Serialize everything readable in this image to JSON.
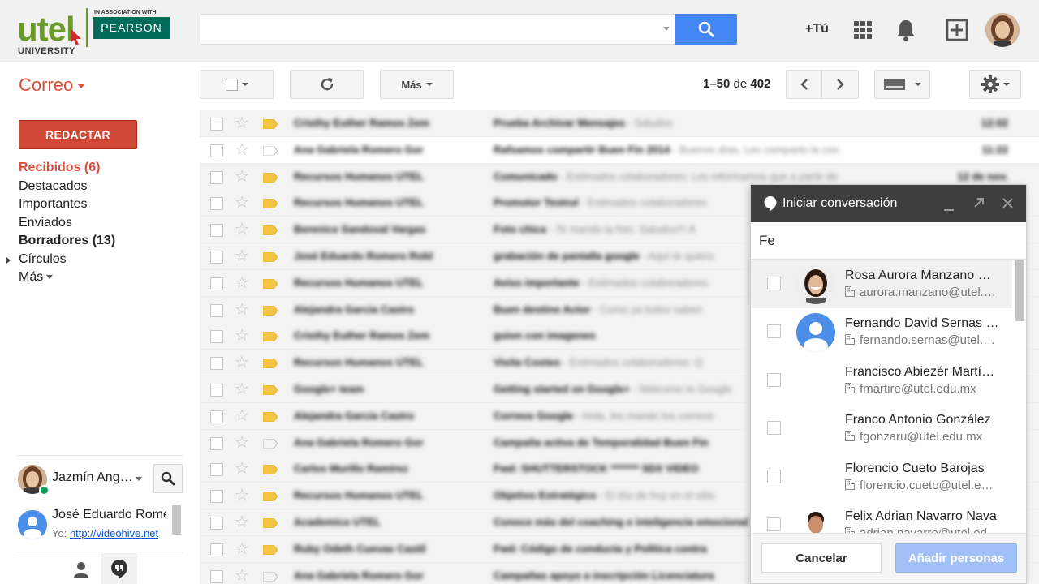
{
  "header": {
    "logo_main": "utel",
    "logo_sub": "UNIVERSITY",
    "logo_assoc": "IN ASSOCIATION WITH",
    "logo_partner": "PEARSON",
    "search_value": "",
    "plus_you": "+Tú",
    "icons": [
      "search-icon",
      "apps-grid-icon",
      "notification-bell-icon",
      "add-share-icon",
      "profile-avatar"
    ],
    "search_button_color": "#4285f4"
  },
  "toolbar": {
    "app_label": "Correo",
    "more_label": "Más",
    "pager_range": "1–50",
    "pager_of": "de",
    "pager_total": "402"
  },
  "nav": {
    "compose_label": "REDACTAR",
    "compose_color": "#d14836",
    "items": [
      {
        "label": "Recibidos (6)",
        "state": "active"
      },
      {
        "label": "Destacados",
        "state": ""
      },
      {
        "label": "Importantes",
        "state": ""
      },
      {
        "label": "Enviados",
        "state": ""
      },
      {
        "label": "Borradores (13)",
        "state": "bold"
      },
      {
        "label": "Círculos",
        "state": "expandable"
      },
      {
        "label": "Más",
        "state": "dropdown"
      }
    ]
  },
  "chat": {
    "me_name": "Jazmín Angélica",
    "contact_name": "José Eduardo Romero",
    "contact_prefix": "Yo:",
    "contact_link": "http://videohive.net"
  },
  "messages": [
    {
      "sender": "Cristhy Euther Ramos Zem",
      "subject": "Prueba Archivar Mensajes",
      "snippet": " - Saludos",
      "date": "12:02",
      "read": true,
      "tagged": true
    },
    {
      "sender": "Ana Gabriela Romero Gor",
      "subject": "Rafsamos compartir Buen Fin 2014",
      "snippet": " - Buenos días, Les comparto la con",
      "date": "11:22",
      "read": false,
      "tagged": false
    },
    {
      "sender": "Recursos Humanos UTEL",
      "subject": "Comunicado",
      "snippet": " - Estimados colaboradores: Les informamos que a partir de",
      "date": "12 de nov.",
      "read": true,
      "tagged": true
    },
    {
      "sender": "Recursos Humanos UTEL",
      "subject": "Promotor Testrul",
      "snippet": " - Estimados colaboradores",
      "date": "",
      "read": true,
      "tagged": true
    },
    {
      "sender": "Berenice Sandoval Vargas",
      "subject": "Foto chica",
      "snippet": " - Te mando la foto. Saludos!!! A",
      "date": "",
      "read": true,
      "tagged": true
    },
    {
      "sender": "José Eduardo Romero Robl",
      "subject": "grabación de pantalla google",
      "snippet": " - Aquí te quiero",
      "date": "",
      "read": true,
      "tagged": true
    },
    {
      "sender": "Recursos Humanos UTEL",
      "subject": "Aviso importante",
      "snippet": " - Estimados colaboradores",
      "date": "",
      "read": true,
      "tagged": true
    },
    {
      "sender": "Alejandra Garcia Castro",
      "subject": "Buen destino Actor",
      "snippet": " - Como ya todos saben",
      "date": "",
      "read": true,
      "tagged": true
    },
    {
      "sender": "Cristhy Euther Ramos Zem",
      "subject": "guion con imagenes",
      "snippet": "",
      "date": "",
      "read": true,
      "tagged": true
    },
    {
      "sender": "Recursos Humanos UTEL",
      "subject": "Visita Costeo",
      "snippet": " - Estimados colaboradores: Q",
      "date": "",
      "read": true,
      "tagged": true
    },
    {
      "sender": "Google+ team",
      "subject": "Getting started on Google+",
      "snippet": " - Welcome to Google",
      "date": "",
      "read": true,
      "tagged": true
    },
    {
      "sender": "Alejandra Garcia Castro",
      "subject": "Correos Google",
      "snippet": " - Hola, les mando los correos",
      "date": "",
      "read": true,
      "tagged": true
    },
    {
      "sender": "Ana Gabriela Romero Gor",
      "subject": "Campaña activa de Temporalidad Buen Fin",
      "snippet": "",
      "date": "",
      "read": true,
      "tagged": false
    },
    {
      "sender": "Carlos Murillo Ramírez",
      "subject": "Fwd: SHUTTERSTOCK ******* 5DX VIDEO",
      "snippet": "",
      "date": "",
      "read": true,
      "tagged": true
    },
    {
      "sender": "Recursos Humanos UTEL",
      "subject": "Objetivo Estratégico",
      "snippet": " - El día de hoy en el sitio",
      "date": "",
      "read": true,
      "tagged": true
    },
    {
      "sender": "Academico UTEL",
      "subject": "Conoce más del coaching e inteligencia emocional",
      "snippet": "",
      "date": "",
      "read": true,
      "tagged": true
    },
    {
      "sender": "Ruby Odeth Cuevas Castil",
      "subject": "Fwd: Código de conducta y Política contra",
      "snippet": "",
      "date": "",
      "read": true,
      "tagged": true
    },
    {
      "sender": "Ana Gabriela Romero Gor",
      "subject": "Campañas apoyo a inscripción Licenciatura",
      "snippet": "",
      "date": "",
      "read": true,
      "tagged": false
    }
  ],
  "popup": {
    "title": "Iniciar conversación",
    "input_value": "Fe",
    "people": [
      {
        "name": "Rosa Aurora Manzano Sánchez",
        "email": "aurora.manzano@utel.edu.mx",
        "avatar": "photo-woman",
        "highlight": true
      },
      {
        "name": "Fernando David Sernas Ruiz",
        "email": "fernando.sernas@utel.edu.mx",
        "avatar": "default-person",
        "highlight": false
      },
      {
        "name": "Francisco Abiezér Martínez",
        "email": "fmartire@utel.edu.mx",
        "avatar": "none",
        "highlight": false
      },
      {
        "name": "Franco Antonio González",
        "email": "fgonzaru@utel.edu.mx",
        "avatar": "none",
        "highlight": false
      },
      {
        "name": "Florencio Cueto Barojas",
        "email": "florencio.cueto@utel.edu.mx",
        "avatar": "none",
        "highlight": false
      },
      {
        "name": "Felix Adrian Navarro Nava",
        "email": "adrian.navarro@utel.edu.mx",
        "avatar": "photo-man",
        "highlight": false
      }
    ],
    "cancel_label": "Cancelar",
    "add_label": "Añadir personas",
    "add_color": "#a0c0f6"
  }
}
